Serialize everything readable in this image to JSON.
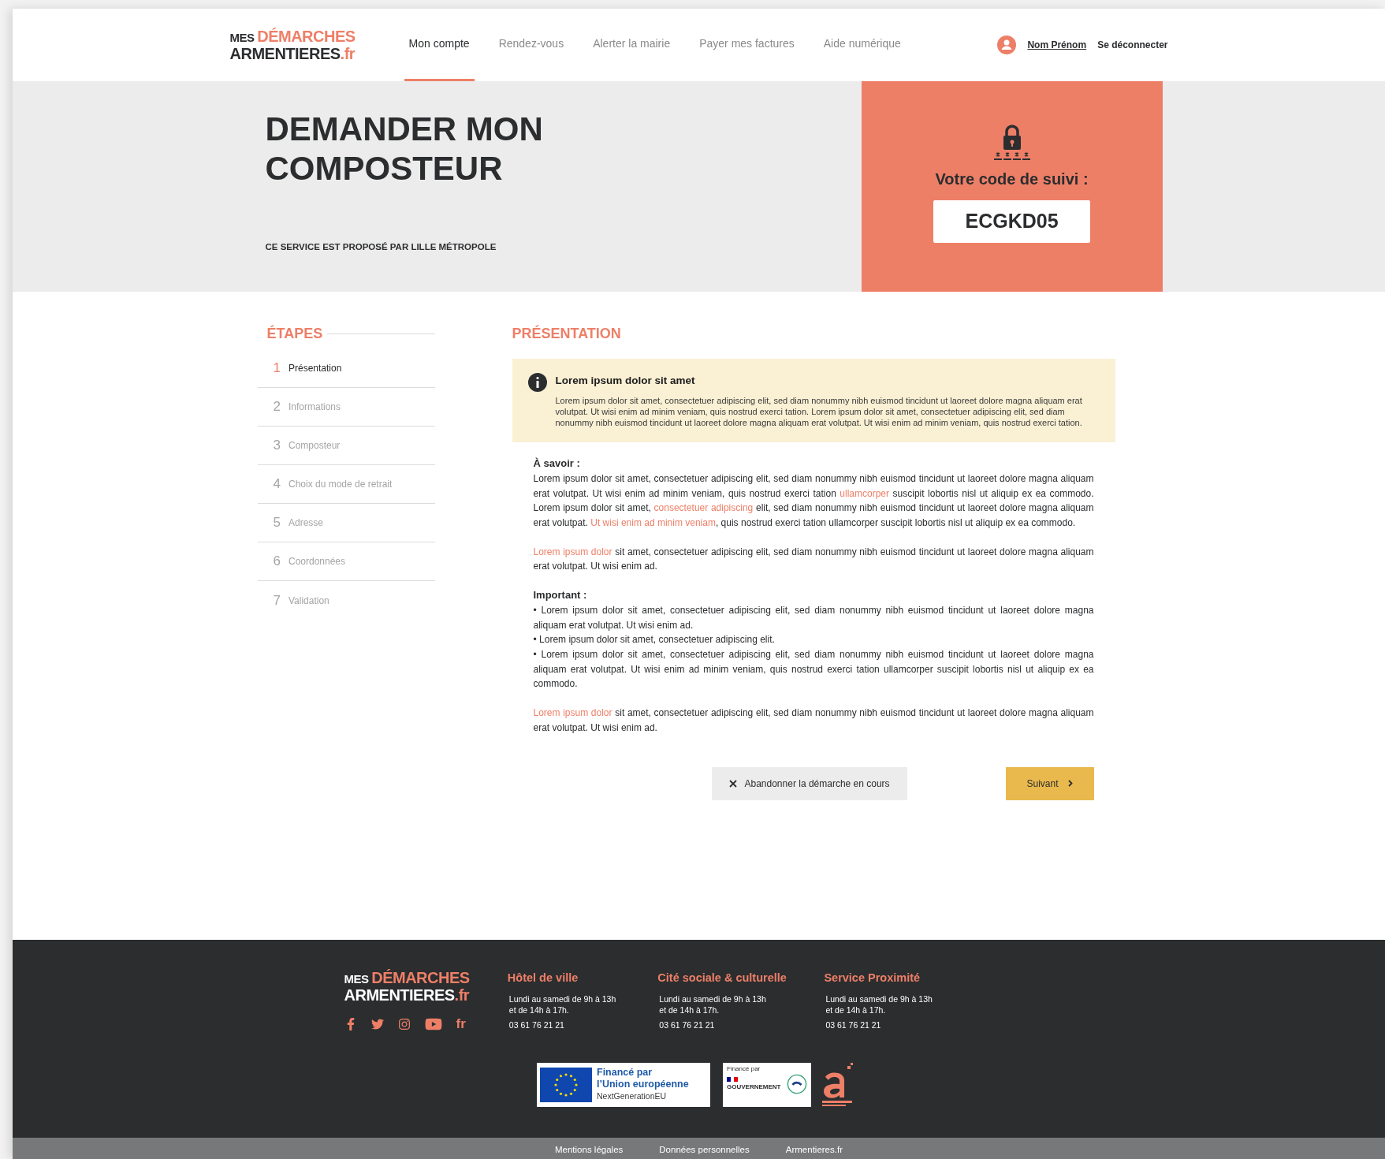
{
  "header": {
    "logo": {
      "top_small": "MES",
      "top_accent": "DÉMARCHES",
      "bottom": "ARMENTIERES",
      "bottom_accent": ".fr"
    },
    "nav": [
      {
        "label": "Mon compte",
        "selected": true
      },
      {
        "label": "Rendez-vous",
        "selected": false
      },
      {
        "label": "Alerter la mairie",
        "selected": false
      },
      {
        "label": "Payer mes factures",
        "selected": false
      },
      {
        "label": "Aide numérique",
        "selected": false
      }
    ],
    "user": {
      "name": "Nom Prénom",
      "logout": "Se déconnecter"
    }
  },
  "hero": {
    "title": "DEMANDER MON COMPOSTEUR",
    "subtitle": "CE SERVICE EST PROPOSÉ PAR LILLE MÉTROPOLE",
    "code_label": "Votre code de suivi :",
    "code": "ECGKD05"
  },
  "steps": {
    "title": "ÉTAPES",
    "items": [
      {
        "number": "1",
        "label": "Présentation",
        "selected": true
      },
      {
        "number": "2",
        "label": "Informations",
        "selected": false
      },
      {
        "number": "3",
        "label": "Composteur",
        "selected": false
      },
      {
        "number": "4",
        "label": "Choix du mode de retrait",
        "selected": false
      },
      {
        "number": "5",
        "label": "Adresse",
        "selected": false
      },
      {
        "number": "6",
        "label": "Coordonnées",
        "selected": false
      },
      {
        "number": "7",
        "label": "Validation",
        "selected": false
      }
    ]
  },
  "content": {
    "title": "PRÉSENTATION",
    "info": {
      "title": "Lorem ipsum dolor sit amet",
      "text": "Lorem ipsum dolor sit amet, consectetuer adipiscing elit, sed diam nonummy nibh euismod tincidunt ut laoreet dolore magna aliquam erat volutpat. Ut wisi enim ad minim veniam, quis nostrud exerci tation. Lorem ipsum dolor sit amet, consectetuer adipiscing elit, sed diam nonummy nibh euismod tincidunt ut laoreet dolore magna aliquam erat volutpat. Ut wisi enim ad minim veniam, quis nostrud exerci tation."
    },
    "blocks": [
      {
        "kind": "heading",
        "text": "À savoir :"
      },
      {
        "kind": "paragraph",
        "segments": [
          {
            "text": "Lorem ipsum dolor sit amet, consectetuer adipiscing elit, sed diam nonummy nibh euismod tincidunt ut laoreet dolore magna aliquam erat volutpat. Ut wisi enim ad minim veniam, quis nostrud exerci tation ",
            "link": false
          },
          {
            "text": "ullamcorper",
            "link": true
          },
          {
            "text": " suscipit lobortis nisl ut aliquip ex ea commodo. Lorem ipsum dolor sit amet, ",
            "link": false
          },
          {
            "text": "consectetuer adipiscing",
            "link": true
          },
          {
            "text": " elit, sed diam nonummy nibh euismod tincidunt ut laoreet dolore magna aliquam erat volutpat. ",
            "link": false
          },
          {
            "text": "Ut wisi enim ad minim veniam",
            "link": true
          },
          {
            "text": ", quis nostrud exerci tation ullamcorper suscipit lobortis nisl ut aliquip ex ea commodo.",
            "link": false
          }
        ]
      },
      {
        "kind": "paragraph",
        "segments": [
          {
            "text": "Lorem ipsum dolor",
            "link": true
          },
          {
            "text": " sit amet, consectetuer adipiscing elit, sed diam nonummy nibh euismod tincidunt ut laoreet dolore magna aliquam erat volutpat. Ut wisi enim ad.",
            "link": false
          }
        ]
      },
      {
        "kind": "heading",
        "text": "Important :"
      },
      {
        "kind": "bullet",
        "text": "• Lorem ipsum dolor sit amet, consectetuer adipiscing elit, sed diam nonummy nibh euismod tincidunt ut laoreet dolore magna aliquam erat volutpat. Ut wisi enim ad."
      },
      {
        "kind": "bullet",
        "text": "• Lorem ipsum dolor sit amet, consectetuer adipiscing elit."
      },
      {
        "kind": "bullet",
        "text": "• Lorem ipsum dolor sit amet, consectetuer adipiscing elit, sed diam nonummy nibh euismod tincidunt ut laoreet dolore magna aliquam erat volutpat. Ut wisi enim ad minim veniam, quis nostrud exerci tation ullamcorper suscipit lobortis nisl ut aliquip ex ea commodo."
      },
      {
        "kind": "paragraph",
        "segments": [
          {
            "text": "Lorem ipsum dolor",
            "link": true
          },
          {
            "text": " sit amet, consectetuer adipiscing elit, sed diam nonummy nibh euismod tincidunt ut laoreet dolore magna aliquam erat volutpat. Ut wisi enim ad.",
            "link": false
          }
        ]
      }
    ],
    "buttons": {
      "cancel": "Abandonner la démarche en cours",
      "next": "Suivant"
    }
  },
  "footer": {
    "logo": {
      "top_small": "MES",
      "top_accent": "DÉMARCHES",
      "bottom": "ARMENTIERES",
      "bottom_accent": ".fr"
    },
    "social": [
      {
        "kind": "facebook"
      },
      {
        "kind": "twitter"
      },
      {
        "kind": "instagram"
      },
      {
        "kind": "youtube"
      },
      {
        "kind": "text",
        "text": "fr"
      }
    ],
    "columns": [
      {
        "title": "Hôtel de ville",
        "hours": [
          "Lundi au samedi de 9h à 13h",
          "et de 14h à 17h."
        ],
        "phone": "03 61 76 21 21"
      },
      {
        "title": "Cité sociale & culturelle",
        "hours": [
          "Lundi au samedi de 9h à 13h",
          "et de 14h à 17h."
        ],
        "phone": "03 61 76 21 21"
      },
      {
        "title": "Service Proximité",
        "hours": [
          "Lundi au samedi de 9h à 13h",
          "et de 14h à 17h."
        ],
        "phone": "03 61 76 21 21"
      }
    ],
    "eu_logo": {
      "line1": "Financé par",
      "line2": "l’Union européenne",
      "line3": "NextGenerationEU"
    },
    "gov_logo": {
      "caption": "Financé par",
      "name": "GOUVERNEMENT"
    },
    "links": [
      "Mentions légales",
      "Données personnelles",
      "Armentieres.fr"
    ]
  }
}
